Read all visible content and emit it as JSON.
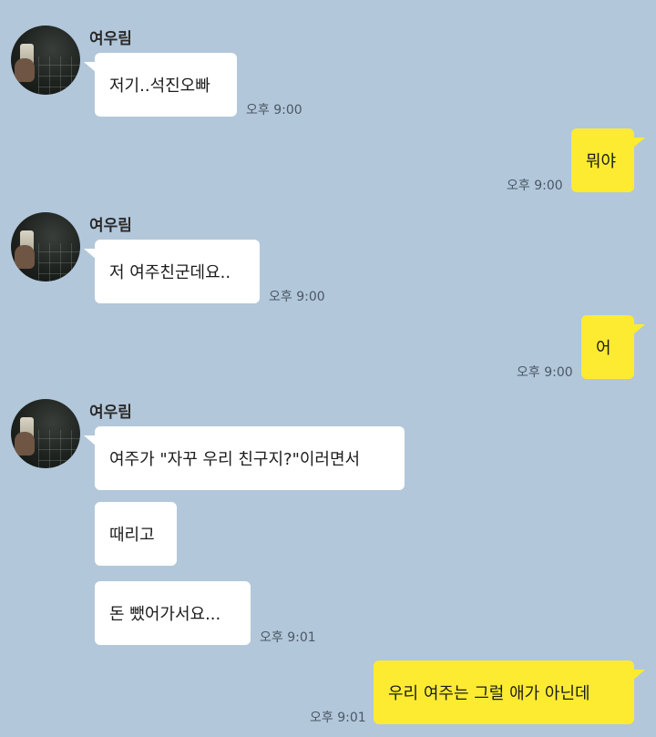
{
  "chat": {
    "sender_name": "여우림",
    "groups": [
      {
        "sender": "여우림",
        "messages": [
          {
            "text": "저기..석진오빠",
            "time": "오후 9:00"
          }
        ]
      },
      {
        "sender": "me",
        "messages": [
          {
            "text": "뭐야",
            "time": "오후 9:00"
          }
        ]
      },
      {
        "sender": "여우림",
        "messages": [
          {
            "text": "저 여주친군데요..",
            "time": "오후 9:00"
          }
        ]
      },
      {
        "sender": "me",
        "messages": [
          {
            "text": "어",
            "time": "오후 9:00"
          }
        ]
      },
      {
        "sender": "여우림",
        "messages": [
          {
            "text": "여주가 \"자꾸 우리 친구지?\"이러면서",
            "time": ""
          },
          {
            "text": "때리고",
            "time": ""
          },
          {
            "text": "돈 뺐어가서요...",
            "time": "오후 9:01"
          }
        ]
      },
      {
        "sender": "me",
        "messages": [
          {
            "text": "우리 여주는 그럴 애가 아닌데",
            "time": "오후 9:01"
          }
        ]
      }
    ]
  },
  "colors": {
    "background": "#b2c7da",
    "incoming_bubble": "#ffffff",
    "outgoing_bubble": "#fdeb31"
  }
}
